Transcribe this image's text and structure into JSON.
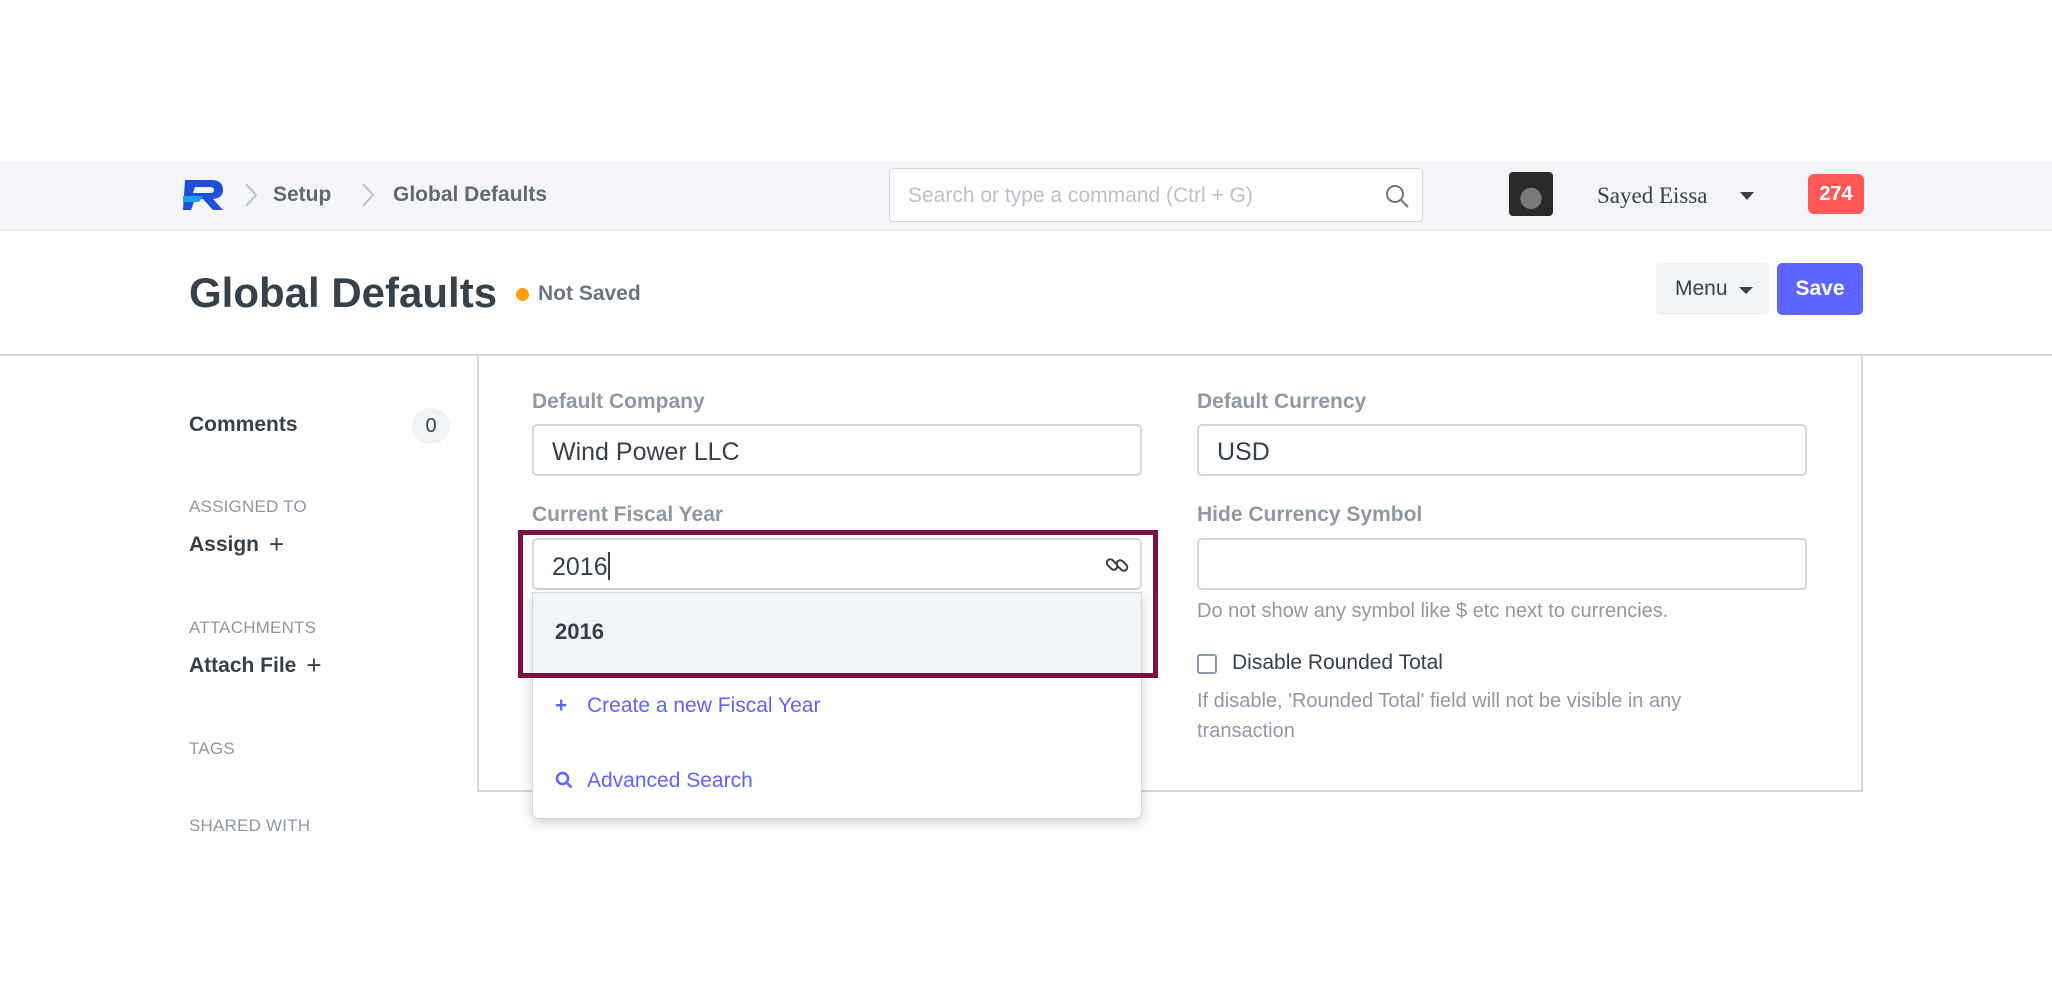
{
  "navbar": {
    "breadcrumbs": [
      "Setup",
      "Global Defaults"
    ],
    "search_placeholder": "Search or type a command (Ctrl + G)",
    "user_name": "Sayed Eissa",
    "notification_count": "274"
  },
  "page": {
    "title": "Global Defaults",
    "status": "Not Saved",
    "menu_label": "Menu",
    "save_label": "Save"
  },
  "sidebar": {
    "comments_label": "Comments",
    "comments_count": "0",
    "assigned_to_label": "ASSIGNED TO",
    "assign_label": "Assign",
    "attachments_label": "ATTACHMENTS",
    "attach_label": "Attach File",
    "tags_label": "TAGS",
    "shared_with_label": "SHARED WITH"
  },
  "form": {
    "default_company": {
      "label": "Default Company",
      "value": "Wind Power LLC"
    },
    "default_currency": {
      "label": "Default Currency",
      "value": "USD"
    },
    "current_fiscal_year": {
      "label": "Current Fiscal Year",
      "value": "2016"
    },
    "hide_currency_symbol": {
      "label": "Hide Currency Symbol",
      "value": "",
      "help": "Do not show any symbol like $ etc next to currencies."
    },
    "disable_rounded_total": {
      "label": "Disable Rounded Total",
      "checked": false,
      "help_line1": "If disable, 'Rounded Total' field will not be visible in any",
      "help_line2": "transaction"
    }
  },
  "dropdown": {
    "items": [
      "2016"
    ],
    "create_label": "Create a new Fiscal Year",
    "advanced_label": "Advanced Search"
  },
  "colors": {
    "primary": "#5e64ff",
    "notification": "#ff5858",
    "status_dot": "#ffa00a",
    "highlight": "#7a1244"
  }
}
